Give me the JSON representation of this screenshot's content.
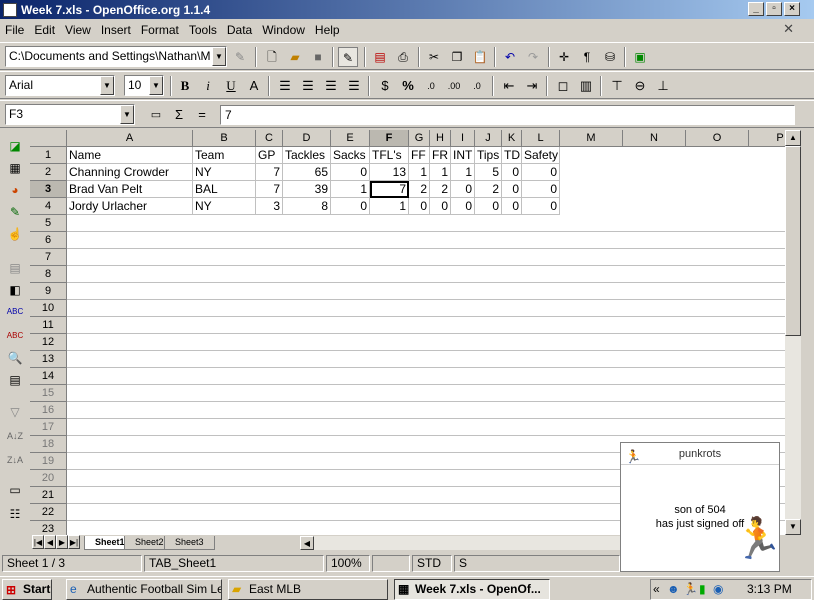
{
  "window": {
    "title": "Week 7.xls - OpenOffice.org 1.1.4"
  },
  "menu": [
    "File",
    "Edit",
    "View",
    "Insert",
    "Format",
    "Tools",
    "Data",
    "Window",
    "Help"
  ],
  "toolbar": {
    "path": "C:\\Documents and Settings\\Nathan\\M",
    "font": "Arial",
    "size": "10",
    "bold": "B",
    "italic": "i",
    "underline": "U"
  },
  "formula": {
    "cellref": "F3",
    "sum": "Σ",
    "eq": "=",
    "value": "7"
  },
  "columns": [
    "A",
    "B",
    "C",
    "D",
    "E",
    "F",
    "G",
    "H",
    "I",
    "J",
    "K",
    "L",
    "M",
    "N",
    "O",
    "P"
  ],
  "rows": [
    "1",
    "2",
    "3",
    "4",
    "5",
    "6",
    "7",
    "8",
    "9",
    "10",
    "11",
    "12",
    "13",
    "14",
    "15",
    "16",
    "17",
    "18",
    "19",
    "20",
    "21",
    "22",
    "23"
  ],
  "header": [
    "Name",
    "Team",
    "GP",
    "Tackles",
    "Sacks",
    "TFL's",
    "FF",
    "FR",
    "INT",
    "Tips",
    "TD",
    "Safety"
  ],
  "data": [
    [
      "Channing Crowder",
      "NY",
      "7",
      "65",
      "0",
      "13",
      "1",
      "1",
      "1",
      "5",
      "0",
      "0"
    ],
    [
      "Brad Van Pelt",
      "BAL",
      "7",
      "39",
      "1",
      "7",
      "2",
      "2",
      "0",
      "2",
      "0",
      "0"
    ],
    [
      "Jordy Urlacher",
      "NY",
      "3",
      "8",
      "0",
      "1",
      "0",
      "0",
      "0",
      "0",
      "0",
      "0"
    ]
  ],
  "tabs": [
    "Sheet1",
    "Sheet2",
    "Sheet3"
  ],
  "status": {
    "sheet": "Sheet 1 / 3",
    "style": "TAB_Sheet1",
    "zoom": "100%",
    "mode": "STD",
    "sum": "S"
  },
  "taskbar": {
    "start": "Start",
    "tasks": [
      "Authentic Football Sim Le...",
      "East MLB",
      "Week 7.xls - OpenOf..."
    ],
    "time": "3:13 PM"
  },
  "popup": {
    "user": "punkrots",
    "line1": "son of 504",
    "line2": "has just signed off"
  }
}
